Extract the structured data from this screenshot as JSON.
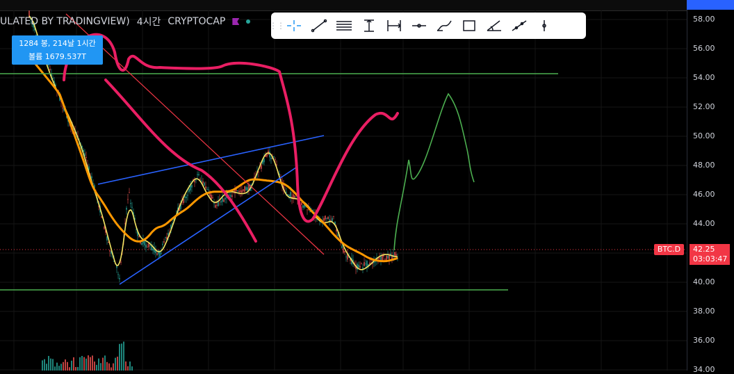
{
  "legend": {
    "title": "ULATED BY TRADINGVIEW)",
    "interval": "4시간",
    "exchange": "CRYPTOCAP"
  },
  "tooltip": {
    "line1": "1284 봉, 214날 1시간",
    "line2": "볼륨 1679.537T"
  },
  "toolbar": {
    "tools": [
      "crosshair-icon",
      "trend-line-icon",
      "parallel-channel-icon",
      "long-position-icon",
      "date-range-icon",
      "horizontal-ray-icon",
      "brush-icon",
      "rectangle-icon",
      "angle-icon",
      "extended-line-icon",
      "vertical-line-icon"
    ],
    "active": "crosshair-icon"
  },
  "axis": {
    "ticks": [
      "58.00",
      "56.00",
      "54.00",
      "52.00",
      "50.00",
      "48.00",
      "46.00",
      "44.00",
      "42.00",
      "40.00",
      "38.00",
      "36.00",
      "34.00"
    ]
  },
  "price": {
    "symbol": "BTC.D",
    "value": "42.25",
    "countdown": "03:03:47"
  },
  "colors": {
    "up": "#26a69a",
    "down": "#ef5350",
    "ma_fast": "#f5e663",
    "ma_slow": "#ff9800",
    "drawing_pink": "#e91e63",
    "drawing_green": "#4caf50",
    "drawing_blue": "#2962ff",
    "drawing_red": "#f23645",
    "price_tag": "#f23645"
  }
}
